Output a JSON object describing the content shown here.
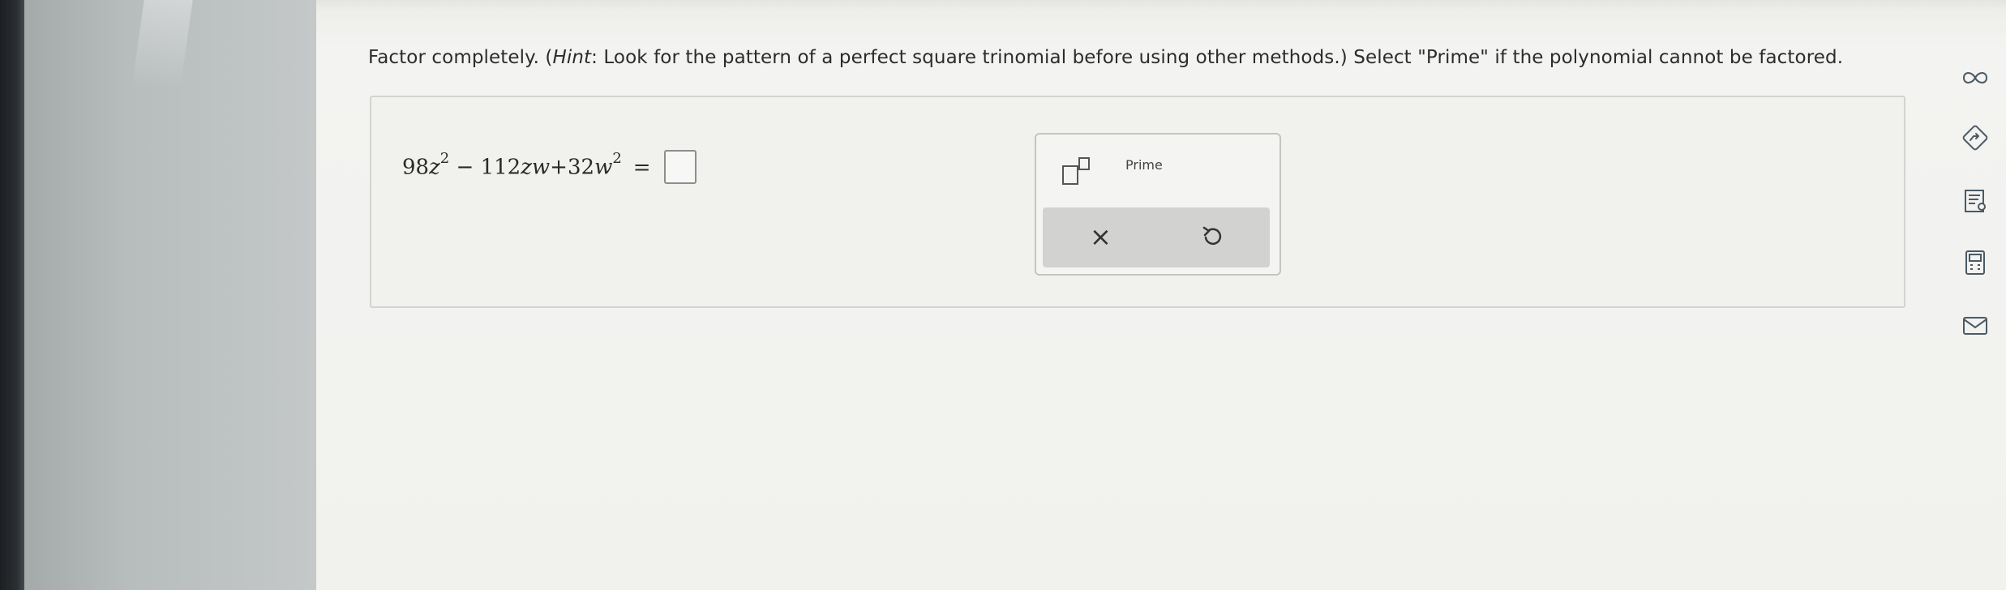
{
  "question": {
    "prefix": "Factor completely. (",
    "hint_word": "Hint",
    "hint_text": ": Look for the pattern of a perfect square trinomial before using other methods.) Select \"Prime\" if the polynomial cannot be factored."
  },
  "expression": {
    "t1_coef": "98",
    "t1_var": "z",
    "t1_exp": "2",
    "op1": "−",
    "t2_coef": "112",
    "t2_var": "zw",
    "op2": "+",
    "t3_coef": "32",
    "t3_var": "w",
    "t3_exp": "2",
    "equals": "=",
    "answer_value": ""
  },
  "palette": {
    "prime_label": "Prime",
    "clear_symbol": "×"
  },
  "toolbar": {
    "icons": [
      "infinity-icon",
      "navigate-icon",
      "worksheet-icon",
      "calculator-icon",
      "mail-icon"
    ]
  }
}
